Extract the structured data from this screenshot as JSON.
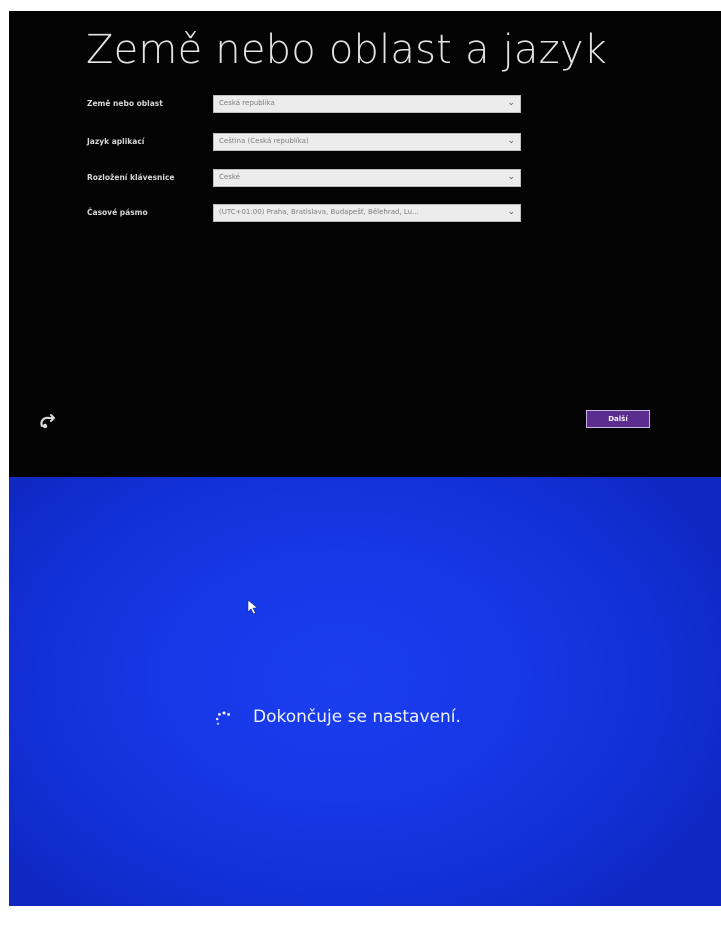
{
  "setup": {
    "title": "Země nebo oblast a jazyk",
    "fields": [
      {
        "label": "Země nebo oblast",
        "value": "Česká republika"
      },
      {
        "label": "Jazyk aplikací",
        "value": "Čeština (Česká republika)"
      },
      {
        "label": "Rozložení klávesnice",
        "value": "České"
      },
      {
        "label": "Časové pásmo",
        "value": "(UTC+01:00) Praha, Bratislava, Budapešť, Bělehrad, Lu..."
      }
    ],
    "next_label": "Další",
    "ease_of_access_icon": "ease-of-access-icon",
    "dropdown_icon": "chevron-down-icon"
  },
  "finishing": {
    "status": "Dokončuje se nastavení.",
    "spinner_icon": "loading-spinner-icon",
    "cursor_icon": "mouse-cursor-icon"
  },
  "colors": {
    "setup_background": "#030303",
    "accent": "#5b2d8e",
    "finishing_background": "#1638e6"
  }
}
